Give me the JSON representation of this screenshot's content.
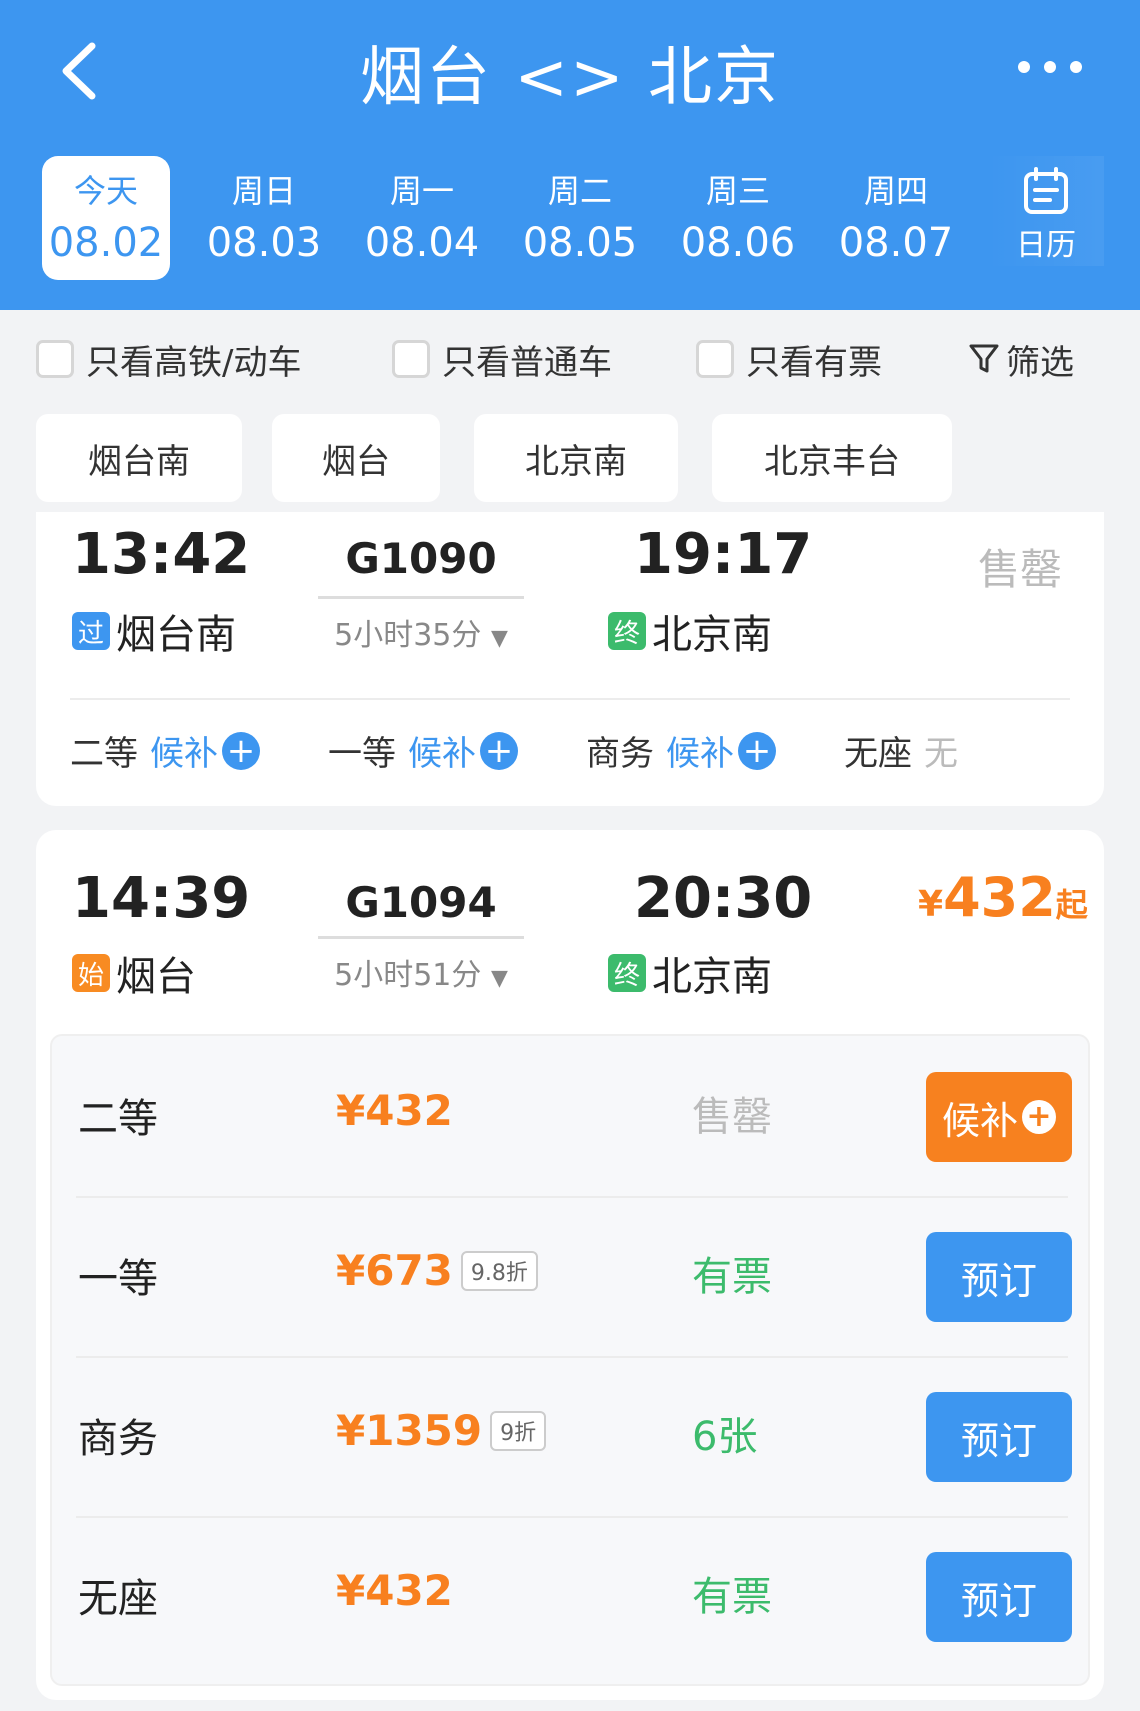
{
  "header": {
    "title": "烟台 <> 北京",
    "back_icon": "chevron-left-icon",
    "more_icon": "more-dots-icon"
  },
  "dates": [
    {
      "weekday": "今天",
      "date": "08.02",
      "active": true
    },
    {
      "weekday": "周日",
      "date": "08.03"
    },
    {
      "weekday": "周一",
      "date": "08.04"
    },
    {
      "weekday": "周二",
      "date": "08.05"
    },
    {
      "weekday": "周三",
      "date": "08.06"
    },
    {
      "weekday": "周四",
      "date": "08.07"
    }
  ],
  "calendar": {
    "label": "日历",
    "icon": "calendar-icon"
  },
  "filters": {
    "high_speed": "只看高铁/动车",
    "normal": "只看普通车",
    "available": "只看有票",
    "filter_label": "筛选",
    "filter_icon": "funnel-icon"
  },
  "stations": [
    "烟台南",
    "烟台",
    "北京南",
    "北京丰台"
  ],
  "trains": [
    {
      "depart_time": "13:42",
      "train_no": "G1090",
      "arrive_time": "19:17",
      "duration": "5小时35分",
      "from_badge": "过",
      "from_station": "烟台南",
      "to_badge": "终",
      "to_station": "北京南",
      "status": "售罄",
      "seats": [
        {
          "class": "二等",
          "status": "候补"
        },
        {
          "class": "一等",
          "status": "候补"
        },
        {
          "class": "商务",
          "status": "候补"
        },
        {
          "class": "无座",
          "status": "无"
        }
      ]
    },
    {
      "depart_time": "14:39",
      "train_no": "G1094",
      "arrive_time": "20:30",
      "duration": "5小时51分",
      "from_badge": "始",
      "from_station": "烟台",
      "to_badge": "终",
      "to_station": "北京南",
      "price_yen": "¥",
      "price_num": "432",
      "price_suffix": "起",
      "seats": [
        {
          "class": "二等",
          "price": "¥432",
          "availability": "售罄",
          "button": "候补"
        },
        {
          "class": "一等",
          "price": "¥673",
          "discount": "9.8折",
          "availability": "有票",
          "button": "预订"
        },
        {
          "class": "商务",
          "price": "¥1359",
          "discount": "9折",
          "availability": "6张",
          "button": "预订"
        },
        {
          "class": "无座",
          "price": "¥432",
          "availability": "有票",
          "button": "预订"
        }
      ]
    }
  ],
  "colors": {
    "primary": "#3d96f0",
    "price": "#f8801f",
    "available": "#3cbb6c",
    "disabled": "#bbbbbb",
    "waitlist_button": "#f7811f"
  }
}
